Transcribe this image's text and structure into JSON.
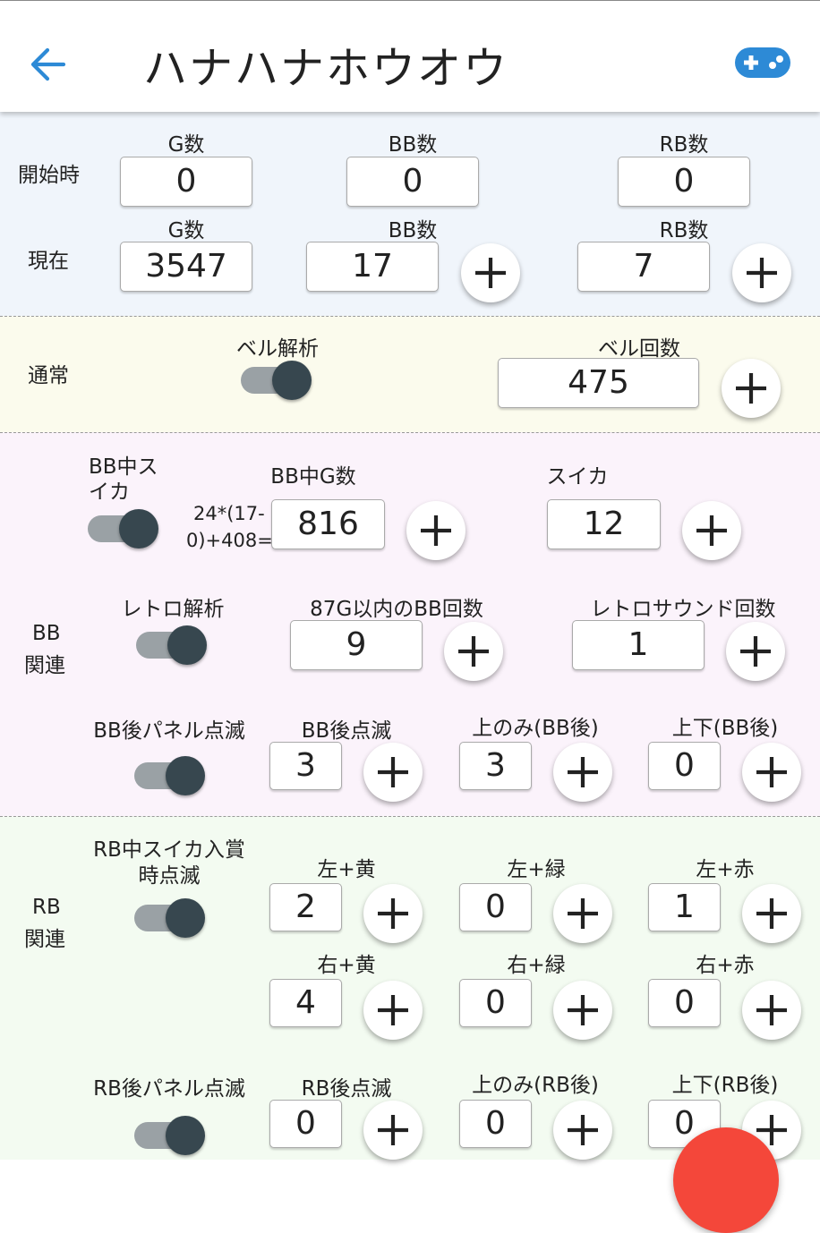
{
  "appbar": {
    "title": "ハナハナホウオウ"
  },
  "start": {
    "row_label": "開始時",
    "g": {
      "label": "G数",
      "value": "0"
    },
    "bb": {
      "label": "BB数",
      "value": "0"
    },
    "rb": {
      "label": "RB数",
      "value": "0"
    }
  },
  "current": {
    "row_label": "現在",
    "g": {
      "label": "G数",
      "value": "3547"
    },
    "bb": {
      "label": "BB数",
      "value": "17"
    },
    "rb": {
      "label": "RB数",
      "value": "7"
    }
  },
  "normal": {
    "row_label": "通常",
    "bell_analysis": {
      "label": "ベル解析",
      "on": true
    },
    "bell_count": {
      "label": "ベル回数",
      "value": "475"
    }
  },
  "bb_section": {
    "row_label_1": "BB",
    "row_label_2": "関連",
    "suika_toggle": {
      "label_1": "BB中ス",
      "label_2": "イカ",
      "on": true
    },
    "formula_1": "24*(17-",
    "formula_2": "0)+408=",
    "bb_g": {
      "label": "BB中G数",
      "value": "816"
    },
    "suika": {
      "label": "スイカ",
      "value": "12"
    },
    "retro_toggle": {
      "label": "レトロ解析",
      "on": true
    },
    "within87": {
      "label": "87G以内のBB回数",
      "value": "9"
    },
    "retro_sound": {
      "label": "レトロサウンド回数",
      "value": "1"
    },
    "panel_toggle": {
      "label": "BB後パネル点滅",
      "on": true
    },
    "after_blink": {
      "label": "BB後点滅",
      "value": "3"
    },
    "top_only": {
      "label": "上のみ(BB後)",
      "value": "3"
    },
    "top_bottom": {
      "label": "上下(BB後)",
      "value": "0"
    }
  },
  "rb_section": {
    "row_label_1": "RB",
    "row_label_2": "関連",
    "suika_toggle": {
      "label_1": "RB中スイカ入賞",
      "label_2": "時点滅",
      "on": true
    },
    "left_yellow": {
      "label": "左+黄",
      "value": "2"
    },
    "left_green": {
      "label": "左+緑",
      "value": "0"
    },
    "left_red": {
      "label": "左+赤",
      "value": "1"
    },
    "right_yellow": {
      "label": "右+黄",
      "value": "4"
    },
    "right_green": {
      "label": "右+緑",
      "value": "0"
    },
    "right_red": {
      "label": "右+赤",
      "value": "0"
    },
    "panel_toggle": {
      "label": "RB後パネル点滅",
      "on": true
    },
    "after_blink": {
      "label": "RB後点滅",
      "value": "0"
    },
    "top_only": {
      "label": "上のみ(RB後)",
      "value": "0"
    },
    "top_bottom": {
      "label": "上下(RB後)",
      "value": "0"
    }
  },
  "colors": {
    "accent_blue": "#2d8ad6",
    "start_bg": "#f0f5fb",
    "normal_bg": "#fbfbed",
    "bb_bg": "#fbf3fb",
    "rb_bg": "#f3fbf1",
    "toggle_knob": "#37474f",
    "fab": "#f4473a"
  },
  "icons": {
    "back": "arrow-left-icon",
    "game": "gamepad-icon",
    "increment": "plus-icon"
  }
}
